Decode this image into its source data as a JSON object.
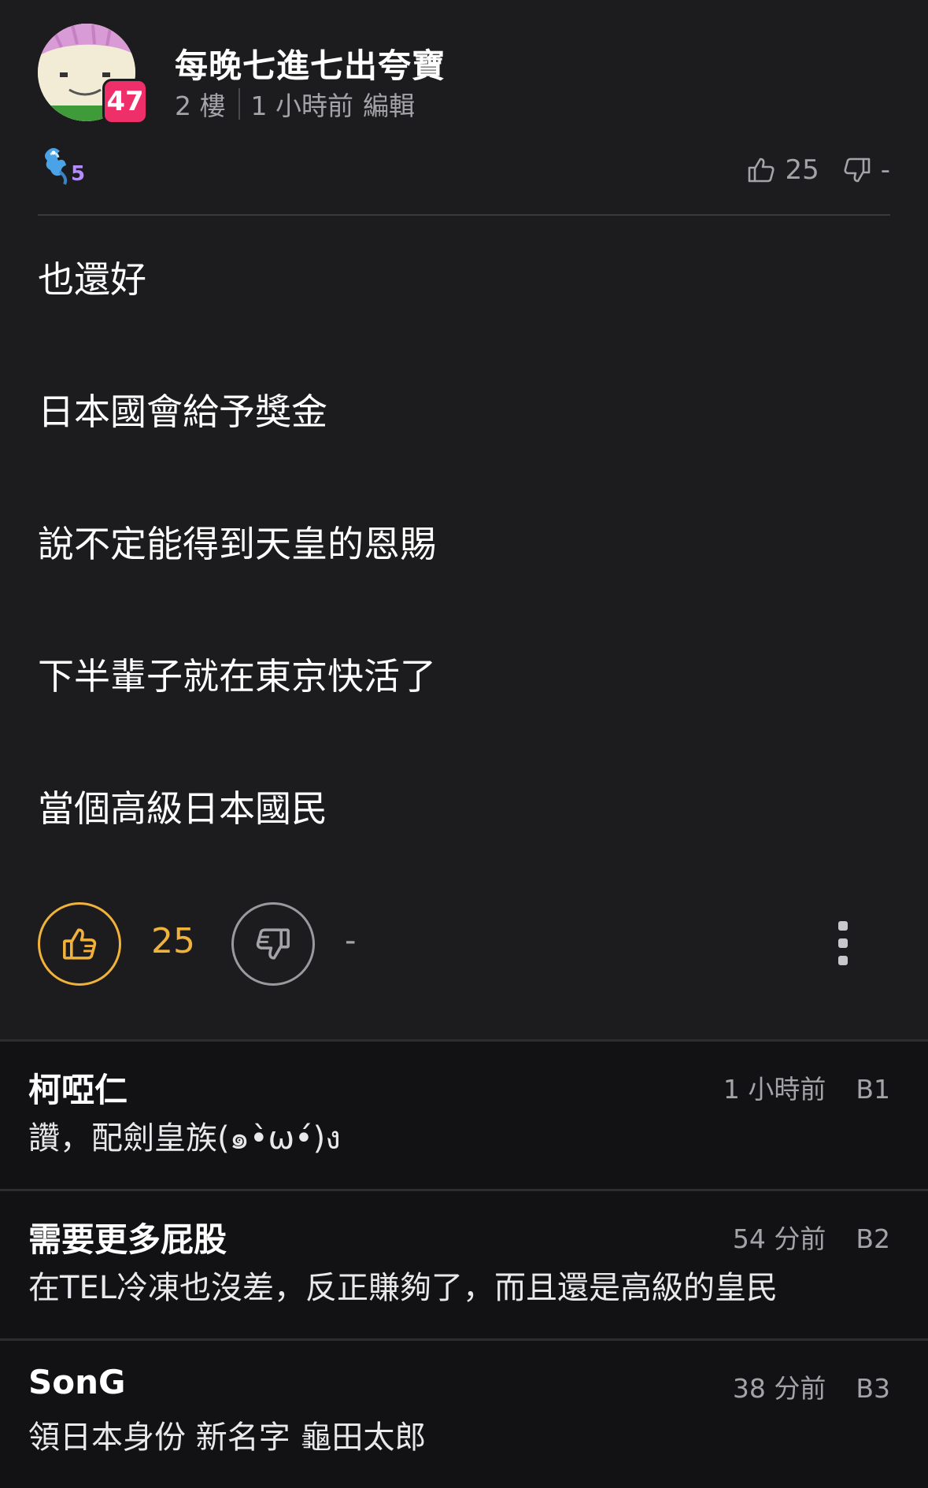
{
  "post": {
    "author": "每晚七進七出夸寶",
    "level": "47",
    "floor": "2 樓",
    "time": "1 小時前",
    "edit_label": "編輯",
    "medal_level": "5",
    "top_likes": "25",
    "top_dislikes": "-",
    "lines": [
      "也還好",
      "日本國會給予獎金",
      "說不定能得到天皇的恩賜",
      "下半輩子就在東京快活了",
      "當個高級日本國民"
    ]
  },
  "actions": {
    "like_count": "25",
    "dislike_count": "-",
    "like_color": "#f0b23a"
  },
  "replies": [
    {
      "author": "柯啞仁",
      "text": "讚，配劍皇族(๑•̀ω•́)ง",
      "time": "1 小時前",
      "floor": "B1"
    },
    {
      "author": "需要更多屁股",
      "text": "在TEL冷凍也沒差，反正賺夠了，而且還是高級的皇民",
      "time": "54 分前",
      "floor": "B2"
    },
    {
      "author": "SonG",
      "text": "領日本身份 新名字 龜田太郎",
      "time": "38 分前",
      "floor": "B3"
    }
  ],
  "icons": {
    "avatar": "avatar-cartoon-face",
    "medal": "dragon-medal-icon",
    "like": "thumbs-up-icon",
    "dislike": "thumbs-down-icon",
    "more": "more-vertical-icon"
  }
}
